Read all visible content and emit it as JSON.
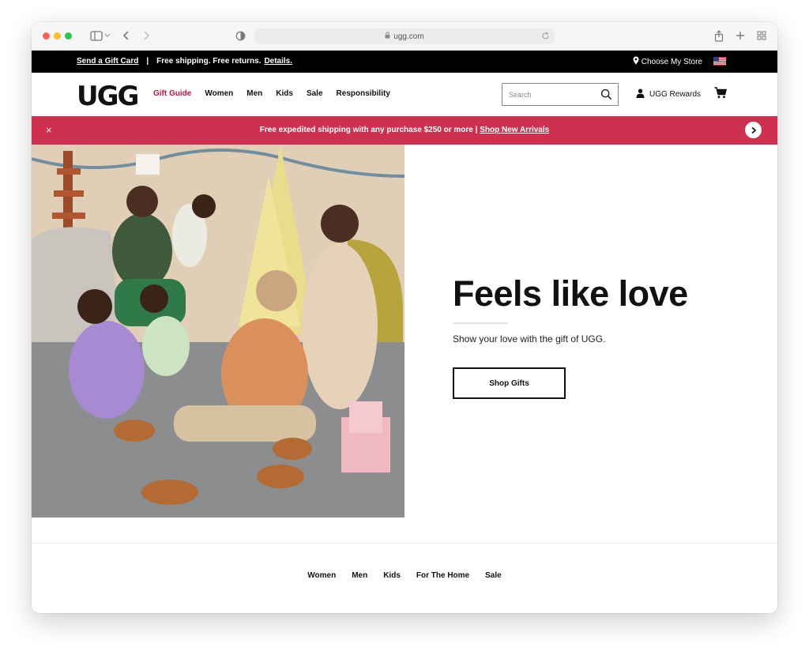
{
  "browser": {
    "url": "ugg.com"
  },
  "promo_bar": {
    "gift_card": "Send a Gift Card",
    "separator": "|",
    "shipping": "Free shipping. Free returns.",
    "details": "Details.",
    "store": "Choose My Store"
  },
  "header": {
    "logo": "UGG",
    "nav": [
      "Gift Guide",
      "Women",
      "Men",
      "Kids",
      "Sale",
      "Responsibility"
    ],
    "search_placeholder": "Search",
    "rewards": "UGG Rewards"
  },
  "shipping_banner": {
    "close": "×",
    "text": "Free expedited shipping with any purchase $250 or more | ",
    "link": "Shop New Arrivals"
  },
  "hero": {
    "headline": "Feels like love",
    "subtext": "Show your love with the gift of UGG.",
    "cta": "Shop Gifts"
  },
  "footer_nav": [
    "Women",
    "Men",
    "Kids",
    "For The Home",
    "Sale"
  ],
  "colors": {
    "accent": "#c8103e",
    "banner": "#d0304f",
    "promo": "#000000"
  }
}
